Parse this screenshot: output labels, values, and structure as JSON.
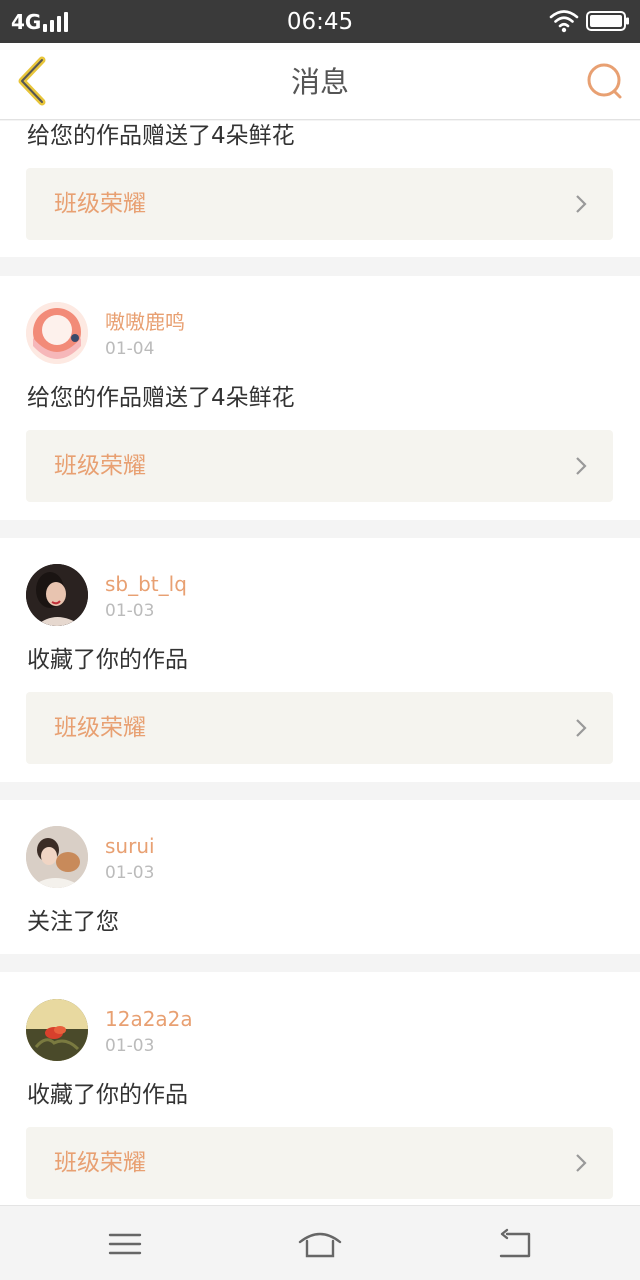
{
  "status_bar": {
    "network": "4G",
    "time": "06:45"
  },
  "header": {
    "title": "消息"
  },
  "link_label": "班级荣耀",
  "messages": [
    {
      "text": "给您的作品赠送了4朵鲜花",
      "link": "班级荣耀"
    },
    {
      "username": "嗷嗷鹿鸣",
      "date": "01-04",
      "text": "给您的作品赠送了4朵鲜花",
      "link": "班级荣耀"
    },
    {
      "username": "sb_bt_lq",
      "date": "01-03",
      "text": "收藏了你的作品",
      "link": "班级荣耀"
    },
    {
      "username": "surui",
      "date": "01-03",
      "text": "关注了您"
    },
    {
      "username": "12a2a2a",
      "date": "01-03",
      "text": "收藏了你的作品",
      "link": "班级荣耀"
    }
  ],
  "colors": {
    "accent": "#e8a072",
    "back_icon": "#e8c53a",
    "link_bg": "#f5f4ef",
    "status_bar": "#3a3a3a"
  }
}
